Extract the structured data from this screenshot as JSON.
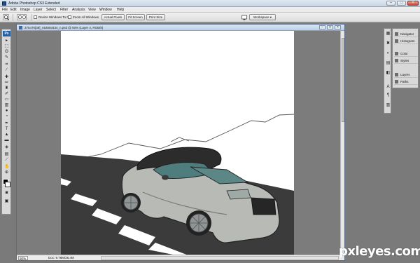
{
  "titlebar": {
    "title": "Adobe Photoshop CS3 Extended",
    "minimize": "–",
    "maximize": "□",
    "close": "×"
  },
  "menu": [
    "File",
    "Edit",
    "Image",
    "Layer",
    "Select",
    "Filter",
    "Analysis",
    "View",
    "Window",
    "Help"
  ],
  "options": {
    "resize_label": "Resize Windows To Fit",
    "zoom_all_label": "Zoom All Windows",
    "actual_pixels": "Actual Pixels",
    "fit_screen": "Fit Screen",
    "print_size": "Print Size",
    "workspace": "Workspace ▾"
  },
  "toolbox": {
    "logo": "Ps"
  },
  "document": {
    "title": "375476[38]_n53593434_n.psd @ 50% (Layer 4, RGB/8)",
    "zoom": "50%",
    "doc_info": "Doc: 9.76M/26.4M"
  },
  "panels": {
    "items": [
      "Navigator",
      "Histogram",
      "Color",
      "Styles",
      "Layers",
      "Paths"
    ]
  },
  "watermark": "pxleyes.com"
}
